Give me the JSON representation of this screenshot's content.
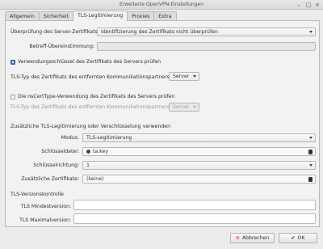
{
  "window": {
    "title": "Erweiterte OpenVPN-Einstellungen"
  },
  "tabs": [
    "Allgemein",
    "Sicherheit",
    "TLS-Legitimierung",
    "Proxies",
    "Extra"
  ],
  "server_cert": {
    "label": "Überprüfung des Server-Zertifikats:",
    "value": "Identifizierung des Zertifikats nicht überprüfen",
    "subject_label": "Betreff-Übereinstimmung:",
    "subject_value": ""
  },
  "key_usage": {
    "checkbox_label": "Verwendungsschlüssel des Zertifikats des Servers prüfen",
    "checked": true,
    "tls_type_label": "TLS-Typ des Zertifikats des entfernten Kommunikationspartners:",
    "tls_type_value": "Server"
  },
  "ns_cert": {
    "checkbox_label": "Die nsCertType-Verwendung des Zertifikats des Servers prüfen",
    "checked": false,
    "tls_type_label": "TLS-Typ des Zertifikats des entfernten Kommunikationspartners:",
    "tls_type_value": "Server"
  },
  "tls_auth": {
    "section_title": "Zusätzliche TLS-Legitimierung oder Verschlüsselung verwenden",
    "mode_label": "Modus:",
    "mode_value": "TLS-Legitimierung",
    "keyfile_label": "Schlüsseldatei:",
    "keyfile_value": "ta.key",
    "direction_label": "Schlüsselrichtung:",
    "direction_value": "1",
    "extra_certs_label": "Zusätzliche Zertifikate:",
    "extra_certs_value": "(keine)"
  },
  "tls_version": {
    "section_title": "TLS-Versionskontrolle",
    "min_label": "TLS Mindestversion:",
    "min_value": "",
    "max_label": "TLS Maximalversion:",
    "max_value": ""
  },
  "buttons": {
    "cancel": "Abbrechen",
    "ok": "OK"
  },
  "colors": {
    "accent": "#4a6fc0",
    "cancel_icon": "#c62828"
  }
}
